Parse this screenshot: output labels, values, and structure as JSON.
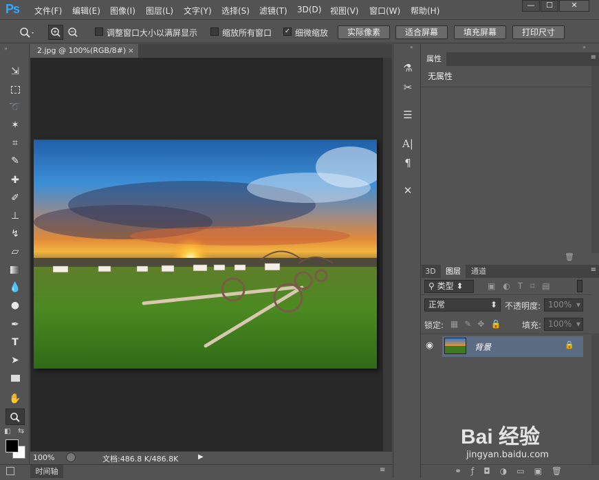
{
  "app": {
    "logo": "Ps"
  },
  "menu": [
    "文件(F)",
    "编辑(E)",
    "图像(I)",
    "图层(L)",
    "文字(Y)",
    "选择(S)",
    "滤镜(T)",
    "3D(D)",
    "视图(V)",
    "窗口(W)",
    "帮助(H)"
  ],
  "window_controls": {
    "minimize": "—",
    "maximize": "☐",
    "close": "✕"
  },
  "options": {
    "resize_windows_label": "调整窗口大小以满屏显示",
    "zoom_all_label": "缩放所有窗口",
    "scrubby_zoom_label": "细微缩放",
    "scrubby_zoom_checked": "✓",
    "actual_pixels": "实际像素",
    "fit_screen": "适合屏幕",
    "fill_screen": "填充屏幕",
    "print_size": "打印尺寸"
  },
  "document": {
    "tab_title": "2.jpg @ 100%(RGB/8#)",
    "tab_close": "×",
    "zoom": "100%",
    "doc_info": "文档:486.8 K/486.8K"
  },
  "timeline": {
    "label": "时间轴"
  },
  "properties": {
    "tab": "属性",
    "content": "无属性"
  },
  "layers": {
    "tabs": [
      "3D",
      "图层",
      "通道"
    ],
    "filter_kind": "类型",
    "blend_mode": "正常",
    "opacity_label": "不透明度:",
    "opacity_value": "100%",
    "lock_label": "锁定:",
    "fill_label": "填充:",
    "fill_value": "100%",
    "items": [
      {
        "name": "背景",
        "visible": true,
        "locked": true
      }
    ]
  },
  "watermark": {
    "brand": "Bai 经验",
    "url": "jingyan.baidu.com"
  },
  "colors": {
    "accent": "#31a8ff",
    "selection": "#5b6b82"
  }
}
